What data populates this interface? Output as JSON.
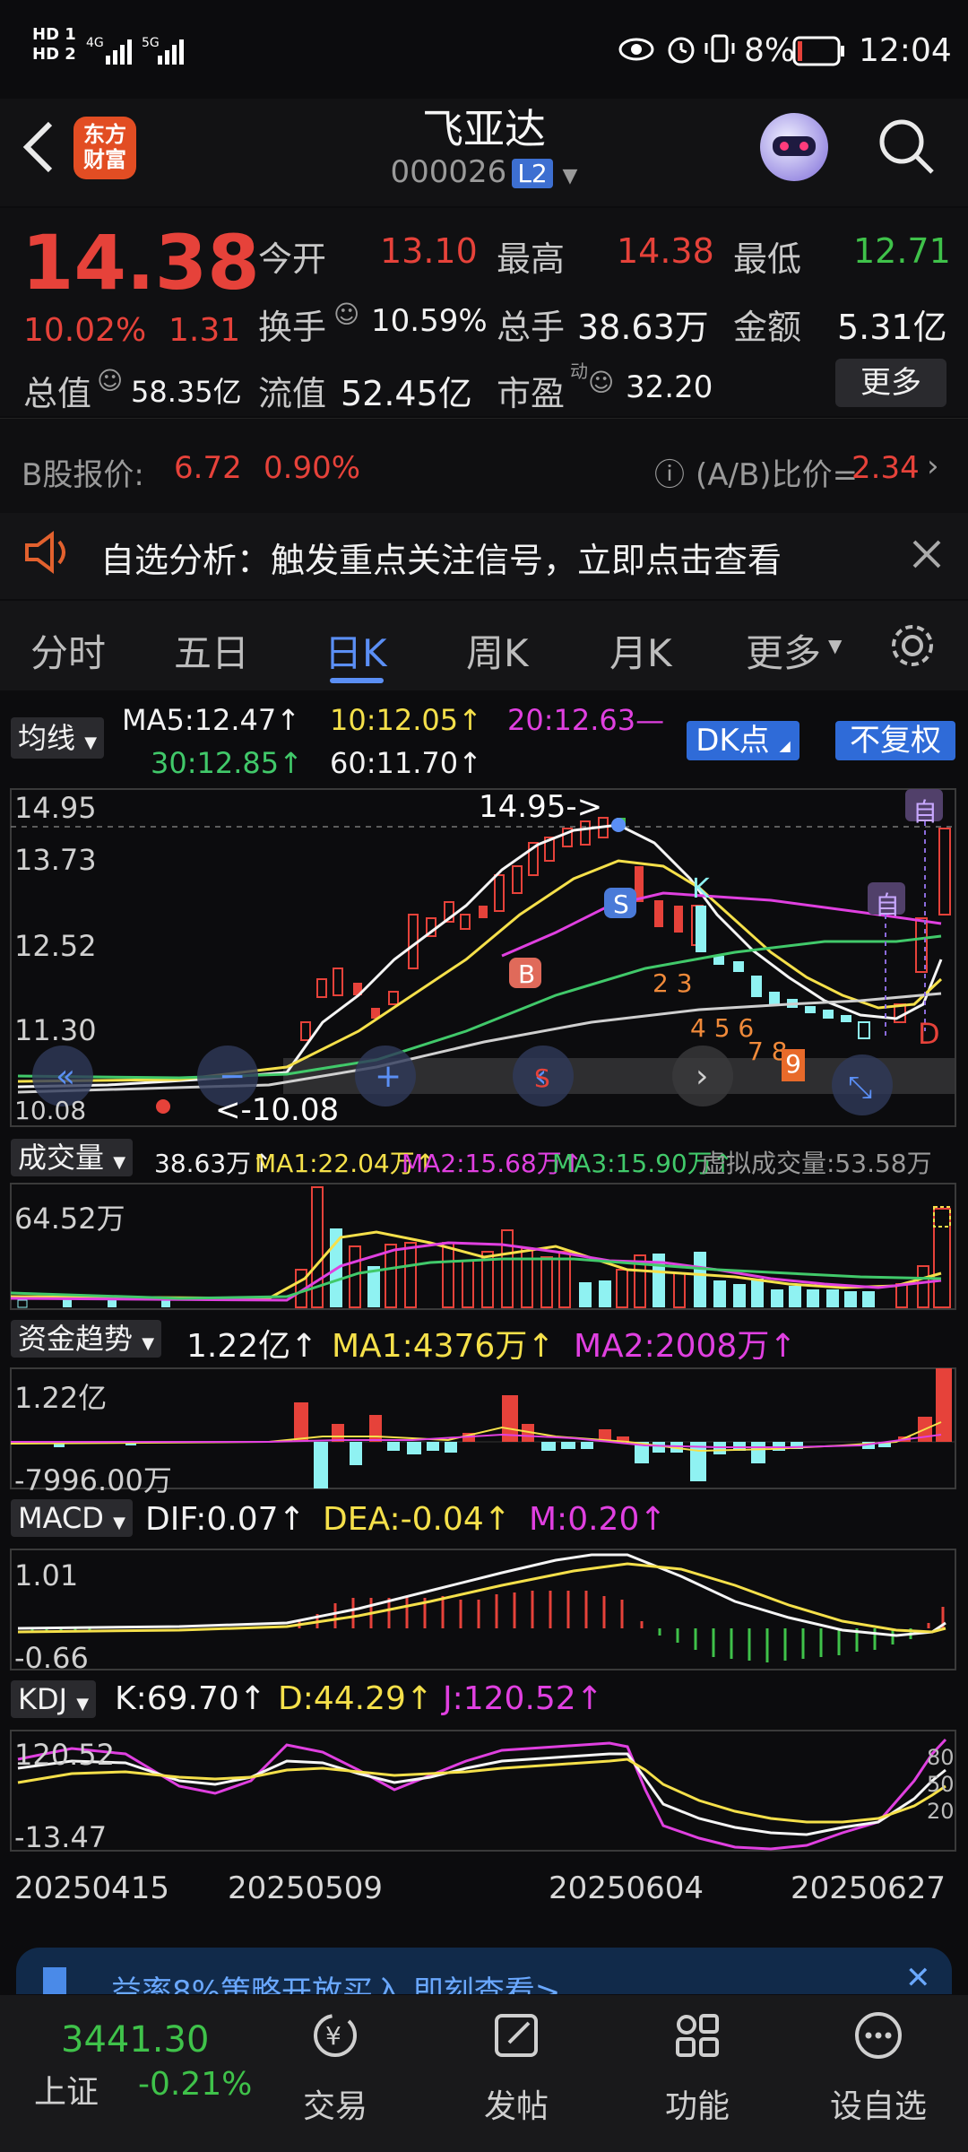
{
  "status_bar": {
    "sim1": "HD 1",
    "sim2": "HD 2",
    "net1": "4G",
    "net2": "5G",
    "battery": "8%",
    "time": "12:04"
  },
  "header": {
    "logo_line1": "东方",
    "logo_line2": "财富",
    "title": "飞亚达",
    "code": "000026",
    "level_badge": "L2"
  },
  "quote": {
    "price": "14.38",
    "change_pct": "10.02%",
    "change_amt": "1.31",
    "open_label": "今开",
    "open": "13.10",
    "high_label": "最高",
    "high": "14.38",
    "low_label": "最低",
    "low": "12.71",
    "turnover_label": "换手",
    "turnover": "10.59%",
    "volume_label": "总手",
    "volume": "38.63万",
    "amount_label": "金额",
    "amount": "5.31亿",
    "mktcap_label": "总值",
    "mktcap": "58.35亿",
    "float_label": "流值",
    "float_cap": "52.45亿",
    "pe_label": "市盈",
    "pe_sup": "动",
    "pe": "32.20",
    "more_label": "更多"
  },
  "bshare": {
    "label": "B股报价:",
    "price": "6.72",
    "pct": "0.90%",
    "ratio_label": "(A/B)比价=",
    "ratio": "2.34"
  },
  "banner": {
    "text": "自选分析：触发重点关注信号，立即点击查看"
  },
  "tabs": [
    "分时",
    "五日",
    "日K",
    "周K",
    "月K",
    "更多"
  ],
  "active_tab": "日K",
  "ma": {
    "select": "均线",
    "ma5": "MA5:12.47",
    "ma10": "10:12.05",
    "ma20": "20:12.63",
    "ma30": "30:12.85",
    "ma60": "60:11.70",
    "dk_btn": "DK点",
    "fq_btn": "不复权"
  },
  "kline": {
    "y1": "14.95",
    "y2": "13.73",
    "y3": "12.52",
    "y4": "11.30",
    "y5": "10.08",
    "max_label": "14.95->",
    "min_label": "<-10.08",
    "mark_auto": "自",
    "mark_d": "D",
    "mark_k": "K",
    "mark_s": "S",
    "mark_b": "B",
    "mark_s2": "S"
  },
  "volume": {
    "select": "成交量",
    "v": "38.63万",
    "ma1": "MA1:22.04万",
    "ma2": "MA2:15.68万",
    "ma3": "MA3:15.90万",
    "virtual": "虚拟成交量:53.58万",
    "y1": "64.52万"
  },
  "fund": {
    "select": "资金趋势",
    "v": "1.22亿",
    "ma1": "MA1:4376万",
    "ma2": "MA2:2008万",
    "y1": "1.22亿",
    "y2": "-7996.00万"
  },
  "macd": {
    "select": "MACD",
    "dif": "DIF:0.07",
    "dea": "DEA:-0.04",
    "m": "M:0.20",
    "y1": "1.01",
    "y2": "-0.66"
  },
  "kdj": {
    "select": "KDJ",
    "k": "K:69.70",
    "d": "D:44.29",
    "j": "J:120.52",
    "y1": "120.52",
    "y2": "-13.47",
    "r80": "80",
    "r50": "50",
    "r20": "20"
  },
  "dates": [
    "20250415",
    "20250509",
    "20250604",
    "20250627"
  ],
  "ad_banner": {
    "text": "益率8%策略开放买入 即刻查看>"
  },
  "index": {
    "value": "3441.30",
    "name": "上证",
    "pct": "-0.21%"
  },
  "nav": [
    "交易",
    "发帖",
    "功能",
    "设自选"
  ],
  "colors": {
    "up": "#e6423a",
    "down": "#3fc24a",
    "accent": "#2f6bd8",
    "panel": "#0c0c0e"
  }
}
